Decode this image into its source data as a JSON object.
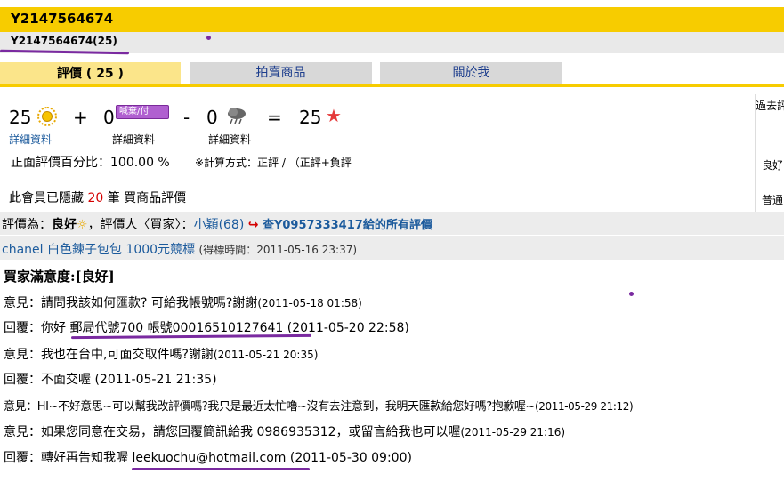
{
  "header": {
    "title": "Y2147564674",
    "user_line": "Y2147564674(25)"
  },
  "tabs": [
    {
      "label": "評價 ( 25 )"
    },
    {
      "label": "拍賣商品"
    },
    {
      "label": "關於我"
    }
  ],
  "summary": {
    "positive_count": "25",
    "plus": "+",
    "cancel_count": "0",
    "cancel_badge": "喊棄/付",
    "minus": "-",
    "negative_count": "0",
    "equals": "=",
    "total": "25",
    "detail_label": "詳細資料",
    "positive_pct_label": "正面評價百分比：100.00 %",
    "calc_note": "※計算方式：正評 / （正評+負評",
    "hidden_prefix": "此會員已隱藏",
    "hidden_count": "20",
    "hidden_suffix": "筆 買商品評價"
  },
  "right_panel": {
    "past": "過去評",
    "good": "良好",
    "normal": "普通"
  },
  "rating": {
    "prefix": "評價為：",
    "value": "良好",
    "rater_prefix": "，評價人〈買家〉：",
    "rater": "小穎",
    "rater_count": "(68)",
    "all_link": "查Y0957333417給的所有評價"
  },
  "item": {
    "title": "chanel 白色鍊子包包 1000元競標",
    "time": "(得標時間：2011-05-16 23:37)"
  },
  "satisfaction": "買家滿意度:[良好]",
  "messages": [
    {
      "text": "意見：請問我該如何匯款? 可給我帳號嗎?謝謝",
      "time": "(2011-05-18 01:58)"
    },
    {
      "text": "回覆：你好 郵局代號700 帳號00016510127641 ",
      "time": "(2011-05-20 22:58)"
    },
    {
      "text": "意見：我也在台中,可面交取件嗎?謝謝",
      "time": "(2011-05-21 20:35)"
    },
    {
      "text": "回覆：不面交喔 ",
      "time": "(2011-05-21 21:35)"
    },
    {
      "text": "意見：HI~不好意思~可以幫我改評價嗎?我只是最近太忙嚕~沒有去注意到，我明天匯款給您好嗎?抱歉喔~",
      "time": "(2011-05-29 21:12)"
    },
    {
      "text": "意見：如果您同意在交易，請您回覆簡訊給我 0986935312，或留言給我也可以喔",
      "time": "(2011-05-29 21:16)"
    },
    {
      "text": "回覆：轉好再告知我喔 leekuochu@hotmail.com ",
      "time": "(2011-05-30 09:00)"
    }
  ],
  "colors": {
    "brand_yellow": "#f7cc00",
    "link_blue": "#1b5a9c",
    "alert_red": "#d40000",
    "annotation_purple": "#7a2aa0"
  }
}
